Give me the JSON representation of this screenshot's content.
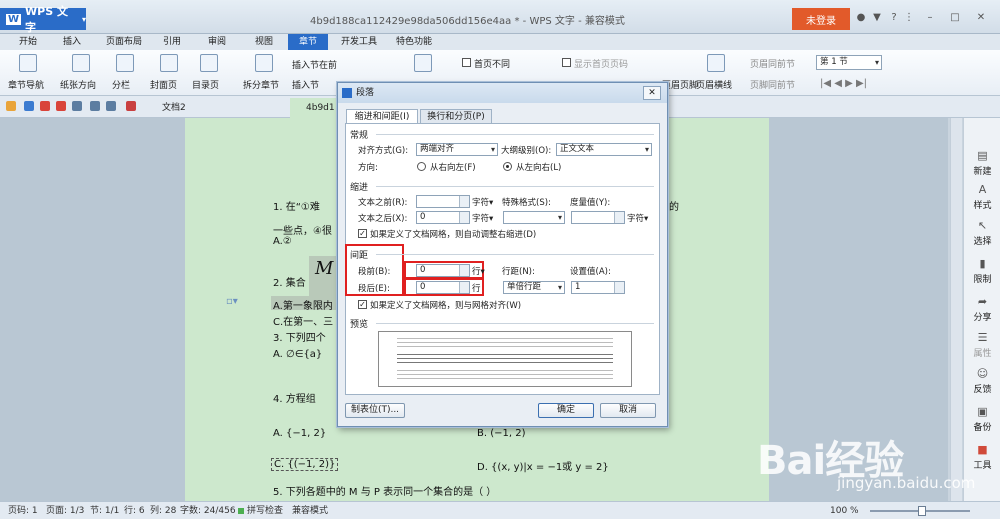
{
  "titlebar": {
    "app": "WPS 文字",
    "doc_title": "4b9d188ca112429e98da506dd156e4aa * - WPS 文字 - 兼容模式",
    "login": "未登录"
  },
  "tabs": [
    "开始",
    "插入",
    "页面布局",
    "引用",
    "审阅",
    "视图",
    "章节",
    "开发工具",
    "特色功能"
  ],
  "active_tab": "章节",
  "ribbon": {
    "chapter_nav": "章节导航",
    "orientation": "纸张方向",
    "columns": "分栏",
    "cover": "封面页",
    "toc": "目录页",
    "split_chapter": "拆分章节",
    "insert_before": "插入节在前",
    "insert_after": "插入节",
    "first_diff": "首页不同",
    "show_first_num": "显示首页页码",
    "header_footer": "页眉页脚",
    "header_line": "页眉横线",
    "header_same": "页眉同前节",
    "footer_same": "页脚同前节",
    "section": "第 1 节"
  },
  "doc_tabs": [
    "文档2",
    "4b9d1"
  ],
  "doc": {
    "q1a": "1.   在“①难",
    "q1b": "的",
    "q1c": "一些点，④很",
    "q1d": "A.②",
    "q2": "2.   集合",
    "q2m": "M",
    "q2a": "A.第一象限内",
    "q2c": "C.在第一、三",
    "q3": "3.   下列四个",
    "q3a": "A. ∅∈{a}",
    "q4": "4.   方程组",
    "q4a": "A. {−1, 2}",
    "q4b": "B. (−1, 2)",
    "q4c": "C. {(−1, 2)}",
    "q4d": "D. {(x, y)|x = −1或 y = 2}",
    "q5": "5.   下列各题中的 M 与 P 表示同一个集合的是（      ）"
  },
  "right_panel": [
    "新建",
    "样式",
    "选择",
    "限制",
    "分享",
    "属性",
    "反馈",
    "备份",
    "工具"
  ],
  "status": {
    "page_code": "页码: 1",
    "pages": "页面: 1/3",
    "section": "节: 1/1",
    "row": "行: 6",
    "col": "列: 28",
    "words": "字数: 24/456",
    "spell": "拼写检查",
    "mode": "兼容模式",
    "zoom": "100 %"
  },
  "dialog": {
    "title": "段落",
    "tabs": [
      "缩进和间距(I)",
      "换行和分页(P)"
    ],
    "general": "常规",
    "align_label": "对齐方式(G):",
    "align_value": "两端对齐",
    "outline_label": "大纲级别(O):",
    "outline_value": "正文文本",
    "direction_label": "方向:",
    "rtl": "从右向左(F)",
    "ltr": "从左向右(L)",
    "indent": "缩进",
    "before_text_label": "文本之前(R):",
    "before_text_value": "",
    "unit_char": "字符▾",
    "special_label": "特殊格式(S):",
    "special_value": "",
    "measure_label": "度量值(Y):",
    "measure_value": "",
    "after_text_label": "文本之后(X):",
    "after_text_value": "0",
    "auto_indent": "如果定义了文档网格，则自动调整右缩进(D)",
    "spacing": "间距",
    "before_label": "段前(B):",
    "before_value": "0",
    "unit_line": "行▾",
    "after_label": "段后(E):",
    "after_value": "0",
    "unit_line2": "行",
    "line_spacing_label": "行距(N):",
    "line_spacing_value": "单倍行距",
    "setting_label": "设置值(A):",
    "setting_value": "1",
    "grid_align": "如果定义了文档网格，则与网格对齐(W)",
    "preview": "预览",
    "tabs_button": "制表位(T)...",
    "ok": "确定",
    "cancel": "取消"
  },
  "watermark": {
    "brand": "Bai经验",
    "url": "jingyan.baidu.com"
  }
}
